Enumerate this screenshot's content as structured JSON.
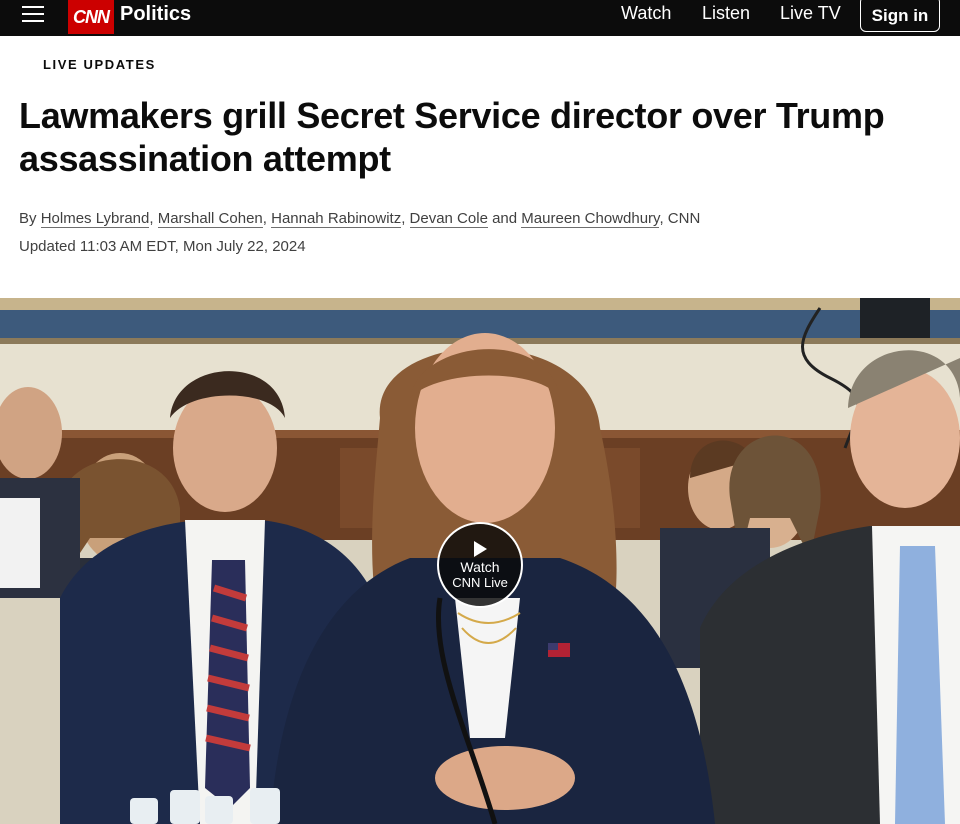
{
  "nav": {
    "brand": "CNN",
    "section": "Politics",
    "links": [
      "Watch",
      "Listen",
      "Live TV"
    ],
    "signin": "Sign in",
    "menu_icon": "hamburger-menu-icon"
  },
  "article": {
    "kicker": "LIVE UPDATES",
    "headline": "Lawmakers grill Secret Service director over Trump assassination attempt",
    "by_prefix": "By ",
    "authors": [
      "Holmes Lybrand",
      "Marshall Cohen",
      "Hannah Rabinowitz",
      "Devan Cole",
      "Maureen Chowdhury"
    ],
    "separators": [
      ", ",
      ", ",
      ", ",
      " and ",
      ", "
    ],
    "source": "CNN",
    "updated": "Updated 11:03 AM EDT, Mon July 22, 2024"
  },
  "media": {
    "watch_line1": "Watch",
    "watch_line2": "CNN Live",
    "play_icon": "play-icon"
  },
  "colors": {
    "nav_bg": "#0c0c0c",
    "brand_red": "#cc0000",
    "text": "#0c0c0c",
    "meta_text": "#404040"
  }
}
